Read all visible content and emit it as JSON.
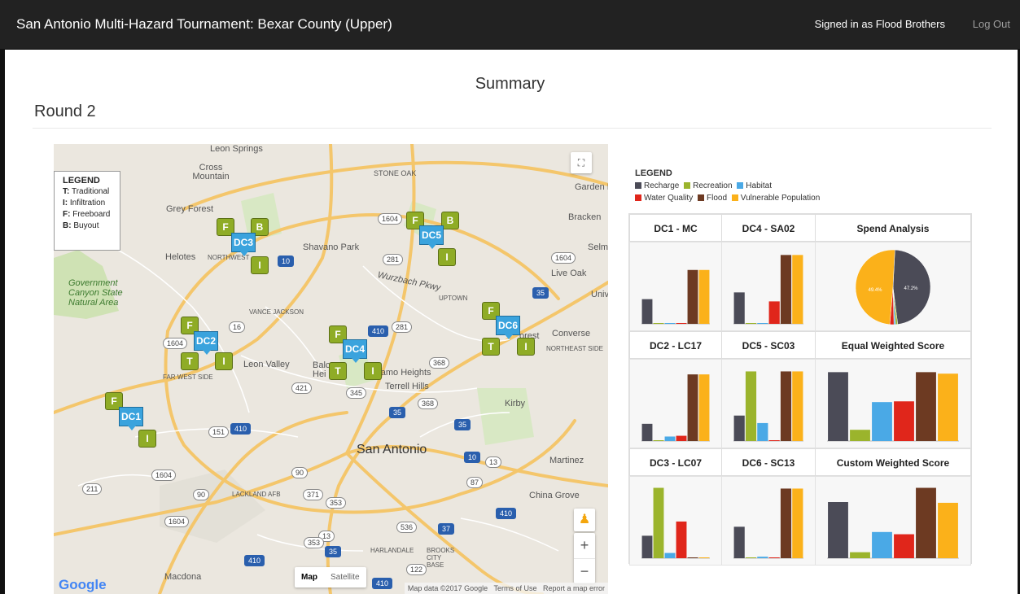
{
  "header": {
    "title": "San Antonio Multi-Hazard Tournament: Bexar County (Upper)",
    "signed_in": "Signed in as Flood Brothers",
    "logout": "Log Out"
  },
  "page": {
    "summary_title": "Summary",
    "round_title": "Round 2"
  },
  "map": {
    "legend": {
      "title": "LEGEND",
      "items": [
        {
          "key": "T:",
          "label": "Traditional"
        },
        {
          "key": "I:",
          "label": "Infiltration"
        },
        {
          "key": "F:",
          "label": "Freeboard"
        },
        {
          "key": "B:",
          "label": "Buyout"
        }
      ]
    },
    "labels": {
      "leon_springs": "Leon Springs",
      "cross_mountain": "Cross Mountain",
      "stone_oak": "STONE OAK",
      "garden_ridge": "Garden R",
      "grey_forest": "Grey Forest",
      "bracken": "Bracken",
      "shavano_park": "Shavano Park",
      "helotes": "Helotes",
      "northwest": "NORTHWEST",
      "selma": "Selm",
      "live_oak": "Live Oak",
      "government_canyon": "Government Canyon State Natural Area",
      "univ": "Unive",
      "wurzbach": "Wurzbach Pkwy",
      "uptown": "UPTOWN",
      "vance_jackson": "VANCE JACKSON",
      "converse": "Converse",
      "northeast_side": "NORTHEAST SIDE",
      "forest": "orest",
      "leon_valley": "Leon Valley",
      "balcones": "Balc Hei",
      "alamo_heights": "Alamo Heights",
      "terrell_hills": "Terrell Hills",
      "far_west_side": "FAR WEST SIDE",
      "kirby": "Kirby",
      "san_antonio": "San Antonio",
      "martinez": "Martinez",
      "lackland": "LACKLAND AFB",
      "china_grove": "China Grove",
      "harlandale": "HARLANDALE",
      "brooks": "BROOKS CITY BASE",
      "macdona": "Macdona"
    },
    "shields": [
      "1604",
      "1604",
      "16",
      "1604",
      "281",
      "10",
      "35",
      "410",
      "281",
      "368",
      "421",
      "345",
      "368",
      "35",
      "151",
      "410",
      "35",
      "10",
      "13",
      "87",
      "90",
      "1604",
      "211",
      "90",
      "371",
      "353",
      "410",
      "1604",
      "536",
      "37",
      "13",
      "353",
      "35",
      "410",
      "122",
      "410"
    ],
    "markers": [
      "F",
      "B",
      "DC3",
      "I",
      "F",
      "B",
      "DC5",
      "I",
      "F",
      "DC6",
      "T",
      "I",
      "F",
      "DC2",
      "T",
      "I",
      "F",
      "DC4",
      "T",
      "I",
      "F",
      "DC1",
      "I"
    ],
    "map_type": {
      "map": "Map",
      "satellite": "Satellite"
    },
    "attribution": {
      "data": "Map data ©2017 Google",
      "terms": "Terms of Use",
      "report": "Report a map error"
    },
    "google": "Google",
    "zoom_in": "+",
    "zoom_out": "−"
  },
  "chart_legend": {
    "title": "LEGEND",
    "items": [
      {
        "label": "Recharge",
        "color": "#4b4b57"
      },
      {
        "label": "Recreation",
        "color": "#9bb42c"
      },
      {
        "label": "Habitat",
        "color": "#4aa9e6"
      },
      {
        "label": "Water Quality",
        "color": "#e0261b"
      },
      {
        "label": "Flood",
        "color": "#6d3a22"
      },
      {
        "label": "Vulnerable Population",
        "color": "#fbb11a"
      }
    ]
  },
  "chart_data": [
    {
      "type": "bar",
      "title": "DC1 - MC",
      "categories": [
        "Recharge",
        "Recreation",
        "Habitat",
        "Water Quality",
        "Flood",
        "Vulnerable Population"
      ],
      "values": [
        33,
        0,
        1,
        1,
        72,
        72
      ],
      "ylim": [
        0,
        100
      ]
    },
    {
      "type": "bar",
      "title": "DC4 - SA02",
      "categories": [
        "Recharge",
        "Recreation",
        "Habitat",
        "Water Quality",
        "Flood",
        "Vulnerable Population"
      ],
      "values": [
        42,
        0,
        1,
        30,
        92,
        92
      ],
      "ylim": [
        0,
        100
      ]
    },
    {
      "type": "pie",
      "title": "Spend Analysis",
      "categories": [
        "Recharge",
        "Recreation",
        "Habitat",
        "Water Quality",
        "Flood",
        "Vulnerable Population"
      ],
      "values": [
        47.2,
        0.9,
        0.7,
        1.8,
        0,
        49.4
      ],
      "labels": [
        "47.2%",
        "49.4%"
      ]
    },
    {
      "type": "bar",
      "title": "DC2 - LC17",
      "categories": [
        "Recharge",
        "Recreation",
        "Habitat",
        "Water Quality",
        "Flood",
        "Vulnerable Population"
      ],
      "values": [
        23,
        0,
        6,
        7,
        89,
        89
      ],
      "ylim": [
        0,
        100
      ]
    },
    {
      "type": "bar",
      "title": "DC5 - SC03",
      "categories": [
        "Recharge",
        "Recreation",
        "Habitat",
        "Water Quality",
        "Flood",
        "Vulnerable Population"
      ],
      "values": [
        34,
        93,
        24,
        0,
        93,
        93
      ],
      "ylim": [
        0,
        100
      ]
    },
    {
      "type": "bar",
      "title": "Equal Weighted Score",
      "categories": [
        "Recharge",
        "Recreation",
        "Habitat",
        "Water Quality",
        "Flood",
        "Vulnerable Population"
      ],
      "values": [
        92,
        15,
        52,
        53,
        92,
        90
      ],
      "ylim": [
        0,
        100
      ]
    },
    {
      "type": "bar",
      "title": "DC3 - LC07",
      "categories": [
        "Recharge",
        "Recreation",
        "Habitat",
        "Water Quality",
        "Flood",
        "Vulnerable Population"
      ],
      "values": [
        30,
        94,
        7,
        49,
        1,
        1
      ],
      "ylim": [
        0,
        100
      ]
    },
    {
      "type": "bar",
      "title": "DC6 - SC13",
      "categories": [
        "Recharge",
        "Recreation",
        "Habitat",
        "Water Quality",
        "Flood",
        "Vulnerable Population"
      ],
      "values": [
        42,
        1,
        2,
        1,
        93,
        93
      ],
      "ylim": [
        0,
        100
      ]
    },
    {
      "type": "bar",
      "title": "Custom Weighted Score",
      "categories": [
        "Recharge",
        "Recreation",
        "Habitat",
        "Water Quality",
        "Flood",
        "Vulnerable Population"
      ],
      "values": [
        75,
        8,
        35,
        32,
        94,
        74
      ],
      "ylim": [
        0,
        100
      ]
    }
  ]
}
